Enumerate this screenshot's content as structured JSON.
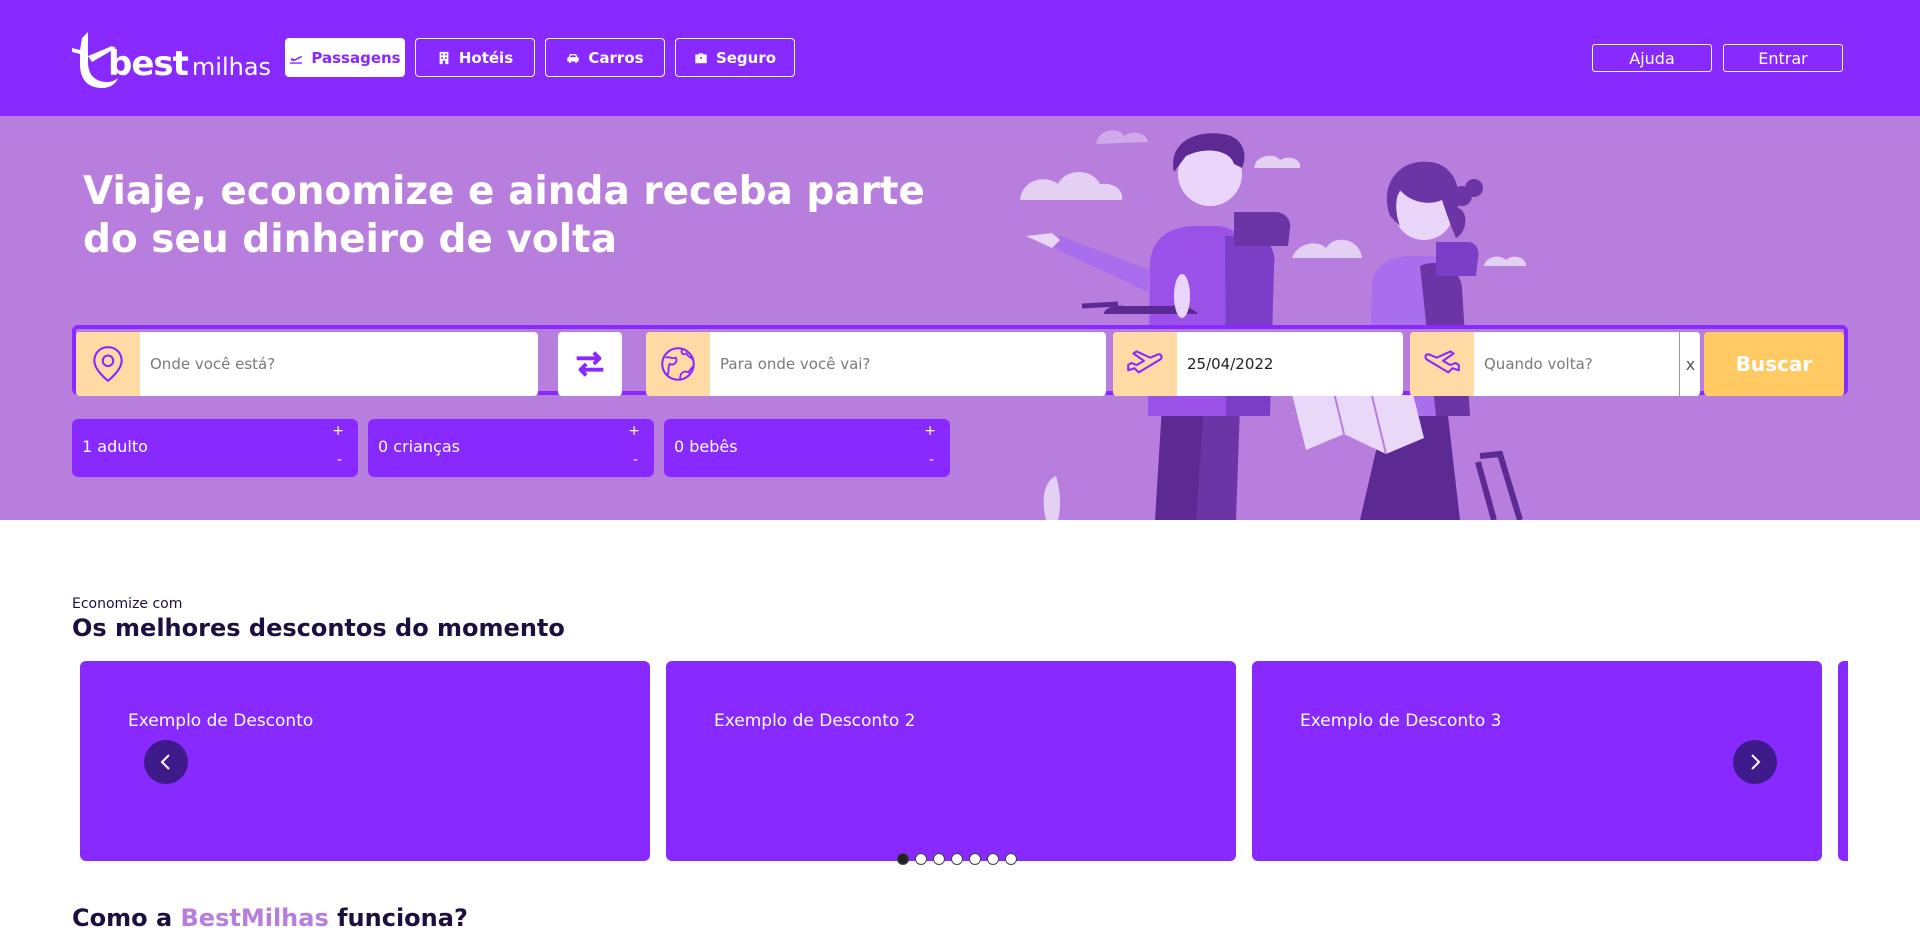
{
  "brand": {
    "part1": "best",
    "part2": "milhas"
  },
  "nav": [
    {
      "label": "Passagens",
      "icon": "airplane-takeoff-icon"
    },
    {
      "label": "Hotéis",
      "icon": "hotel-icon"
    },
    {
      "label": "Carros",
      "icon": "car-icon"
    },
    {
      "label": "Seguro",
      "icon": "briefcase-icon"
    }
  ],
  "auth": {
    "help": "Ajuda",
    "login": "Entrar"
  },
  "hero": {
    "title": "Viaje, economize e ainda receba parte do seu dinheiro de volta"
  },
  "search": {
    "origin_placeholder": "Onde você está?",
    "destination_placeholder": "Para onde você vai?",
    "departure_value": "25/04/2022",
    "return_placeholder": "Quando volta?",
    "clear": "x",
    "submit": "Buscar"
  },
  "passengers": [
    {
      "label": "1 adulto",
      "plus": "+",
      "minus": "-"
    },
    {
      "label": "0 crianças",
      "plus": "+",
      "minus": "-"
    },
    {
      "label": "0 bebês",
      "plus": "+",
      "minus": "-"
    }
  ],
  "discounts": {
    "kicker": "Economize com",
    "title": "Os melhores descontos do momento",
    "cards": [
      "Exemplo de Desconto",
      "Exemplo de Desconto 2",
      "Exemplo de Desconto 3"
    ],
    "dots": 7,
    "active_dot": 0
  },
  "how": {
    "prefix": "Como a ",
    "brand": "BestMilhas",
    "suffix": " funciona?"
  },
  "colors": {
    "primary": "#8729ff",
    "hero_bg": "#b77edd",
    "accent": "#ffca63",
    "icon_bg": "#ffdaa5",
    "dark": "#1d1040"
  }
}
